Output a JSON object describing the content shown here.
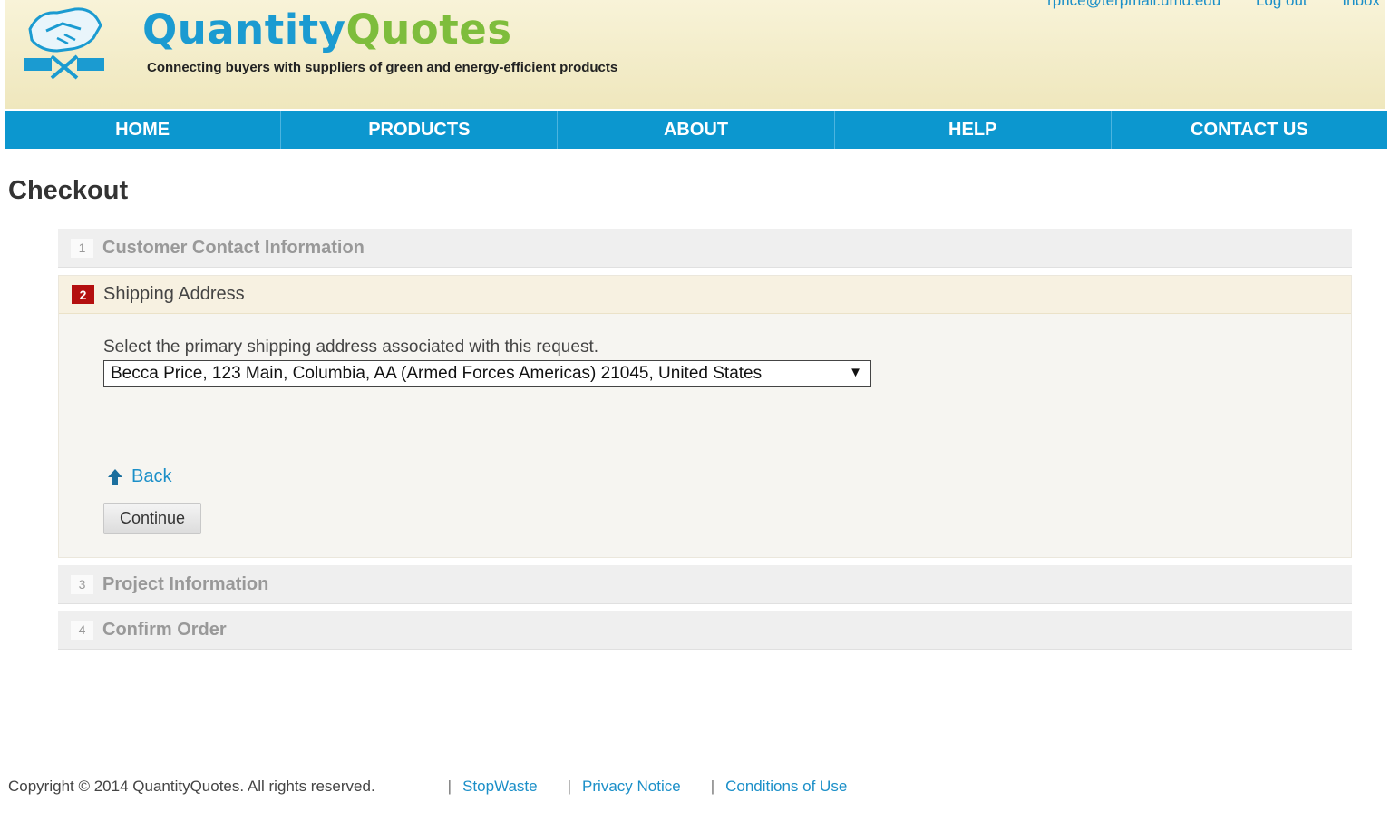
{
  "header": {
    "brand_part1": "Quantity",
    "brand_part2": "Quotes",
    "tagline": "Connecting buyers with suppliers of green and energy-efficient products",
    "user_email": "rprice@terpmail.umd.edu",
    "logout_label": "Log out",
    "inbox_label": "Inbox",
    "brand_colors": {
      "blue": "#1b9bd1",
      "green": "#7ebd3c"
    }
  },
  "nav": {
    "items": [
      {
        "label": "HOME"
      },
      {
        "label": "PRODUCTS"
      },
      {
        "label": "ABOUT"
      },
      {
        "label": "HELP"
      },
      {
        "label": "CONTACT US"
      }
    ],
    "color": "#0c97cf"
  },
  "page": {
    "title": "Checkout"
  },
  "steps": [
    {
      "number": "1",
      "title": "Customer Contact Information",
      "state": "inactive"
    },
    {
      "number": "2",
      "title": "Shipping Address",
      "state": "active"
    },
    {
      "number": "3",
      "title": "Project Information",
      "state": "inactive"
    },
    {
      "number": "4",
      "title": "Confirm Order",
      "state": "inactive"
    }
  ],
  "shipping": {
    "instruction": "Select the primary shipping address associated with this request.",
    "selected_address": "Becca Price, 123 Main, Columbia, AA (Armed Forces Americas) 21045, United States",
    "back_label": "Back",
    "continue_label": "Continue"
  },
  "footer": {
    "copyright": "Copyright © 2014 QuantityQuotes. All rights reserved.",
    "links": [
      "StopWaste",
      "Privacy Notice",
      "Conditions of Use"
    ],
    "separator": "|"
  }
}
